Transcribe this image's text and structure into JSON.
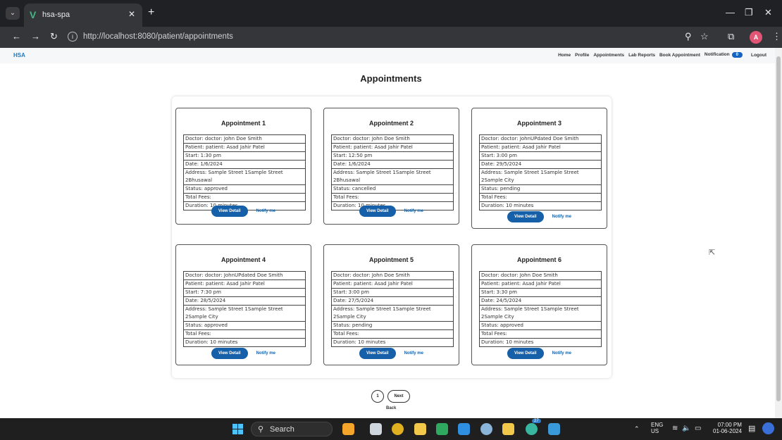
{
  "browser": {
    "tab_title": "hsa-spa",
    "url": "http://localhost:8080/patient/appointments",
    "profile_initial": "A"
  },
  "app": {
    "brand": "HSA",
    "nav": [
      "Home",
      "Profile",
      "Appointments",
      "Lab Reports",
      "Book Appointment",
      "Notification"
    ],
    "notification_count": "0",
    "logout": "Logout"
  },
  "page": {
    "title": "Appointments"
  },
  "appointments": [
    {
      "title": "Appointment 1",
      "fields": [
        "Doctor: doctor: John Doe Smith",
        "Patient: patient: Asad Jahir Patel",
        "Start: 1:30 pm",
        "Date: 1/6/2024",
        "Address: Sample Street 1Sample Street 2Bhusawal",
        "Status: approved",
        "Total Fees:",
        "Duration: 10 minutes"
      ],
      "view_label": "View Detail",
      "notify_label": "Notify me"
    },
    {
      "title": "Appointment 2",
      "fields": [
        "Doctor: doctor: John Doe Smith",
        "Patient: patient: Asad Jahir Patel",
        "Start: 12:50 pm",
        "Date: 1/6/2024",
        "Address: Sample Street 1Sample Street 2Bhusawal",
        "Status: cancelled",
        "Total Fees:",
        "Duration: 10 minutes"
      ],
      "view_label": "View Detail",
      "notify_label": "Notify me"
    },
    {
      "title": "Appointment 3",
      "fields": [
        "Doctor: doctor: JohnUPdated Doe Smith",
        "Patient: patient: Asad Jahir Patel",
        "Start: 3:00 pm",
        "Date: 29/5/2024",
        "Address: Sample Street 1Sample Street 2Sample City",
        "Status: pending",
        "Total Fees:",
        "Duration: 10 minutes"
      ],
      "view_label": "View Detail",
      "notify_label": "Notify me"
    },
    {
      "title": "Appointment 4",
      "fields": [
        "Doctor: doctor: JohnUPdated Doe Smith",
        "Patient: patient: Asad Jahir Patel",
        "Start: 7:30 pm",
        "Date: 28/5/2024",
        "Address: Sample Street 1Sample Street 2Sample City",
        "Status: approved",
        "Total Fees:",
        "Duration: 10 minutes"
      ],
      "view_label": "View Detail",
      "notify_label": "Notify me"
    },
    {
      "title": "Appointment 5",
      "fields": [
        "Doctor: doctor: John Doe Smith",
        "Patient: patient: Asad Jahir Patel",
        "Start: 3:00 pm",
        "Date: 27/5/2024",
        "Address: Sample Street 1Sample Street 2Sample City",
        "Status: pending",
        "Total Fees:",
        "Duration: 10 minutes"
      ],
      "view_label": "View Detail",
      "notify_label": "Notify me"
    },
    {
      "title": "Appointment 6",
      "fields": [
        "Doctor: doctor: John Doe Smith",
        "Patient: patient: Asad Jahir Patel",
        "Start: 3:30 pm",
        "Date: 24/5/2024",
        "Address: Sample Street 1Sample Street 2Sample City",
        "Status: approved",
        "Total Fees:",
        "Duration: 10 minutes"
      ],
      "view_label": "View Detail",
      "notify_label": "Notify me"
    }
  ],
  "pagination": {
    "page": "1",
    "next": "Next",
    "back": "Back"
  },
  "taskbar": {
    "search_label": "Search",
    "lang_top": "ENG",
    "lang_bottom": "US",
    "time": "07:00 PM",
    "date": "01-06-2024",
    "badge_count": "27"
  },
  "colors": {
    "primary": "#1560a8",
    "brand": "#1a7ac0"
  }
}
